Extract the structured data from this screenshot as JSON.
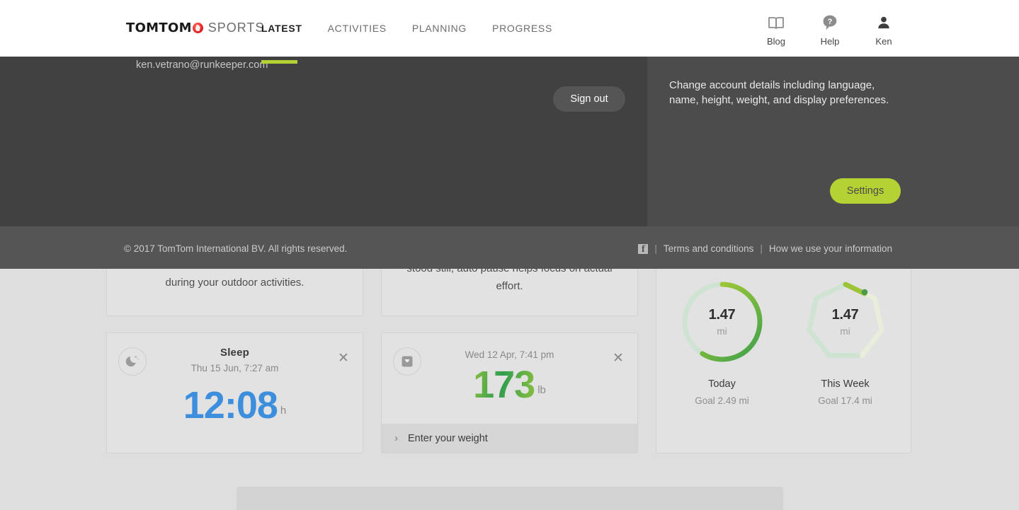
{
  "brand": {
    "logo_primary": "TOMTOM",
    "logo_secondary": "SPORTS",
    "accent_green": "#b5d234",
    "logo_red": "#e8242a"
  },
  "nav": {
    "items": [
      {
        "label": "LATEST",
        "active": true
      },
      {
        "label": "ACTIVITIES",
        "active": false
      },
      {
        "label": "PLANNING",
        "active": false
      },
      {
        "label": "PROGRESS",
        "active": false
      }
    ]
  },
  "utilities": [
    {
      "label": "Blog",
      "icon": "book-icon"
    },
    {
      "label": "Help",
      "icon": "help-bubble-icon"
    },
    {
      "label": "Ken",
      "icon": "person-icon"
    }
  ],
  "account_panel": {
    "user_name": "Ken",
    "user_email": "ken.vetrano@runkeeper.com",
    "sign_out_label": "Sign out",
    "description": "Change account details including language, name, height, weight, and display preferences.",
    "settings_label": "Settings"
  },
  "footer": {
    "copyright": "© 2017 TomTom International BV. All rights reserved.",
    "facebook_glyph": "f",
    "separator": "|",
    "links": [
      {
        "label": "Terms and conditions"
      },
      {
        "label": "How we use your information"
      }
    ]
  },
  "cards": {
    "auto_distance": {
      "text": "during your outdoor activities."
    },
    "auto_pause": {
      "text": "stood still, auto pause helps focus on actual effort."
    },
    "sleep": {
      "icon": "moon-stars-icon",
      "title": "Sleep",
      "subtitle": "Thu 15 Jun, 7:27 am",
      "value": "12:08",
      "unit": "h",
      "value_color": "#3d8fdd",
      "close_glyph": "✕"
    },
    "weight": {
      "icon": "scale-icon",
      "subtitle": "Wed 12 Apr, 7:41 pm",
      "value": "173",
      "unit": "lb",
      "footer_label": "Enter your weight",
      "chevron_glyph": "›",
      "close_glyph": "✕"
    },
    "goals": {
      "rings": [
        {
          "value": "1.47",
          "unit": "mi",
          "label": "Today",
          "goal": "Goal 2.49 mi",
          "shape": "circle",
          "progress_percent": 59
        },
        {
          "value": "1.47",
          "unit": "mi",
          "label": "This Week",
          "goal": "Goal 17.4 mi",
          "shape": "heptagon",
          "progress_percent": 8
        }
      ]
    }
  }
}
